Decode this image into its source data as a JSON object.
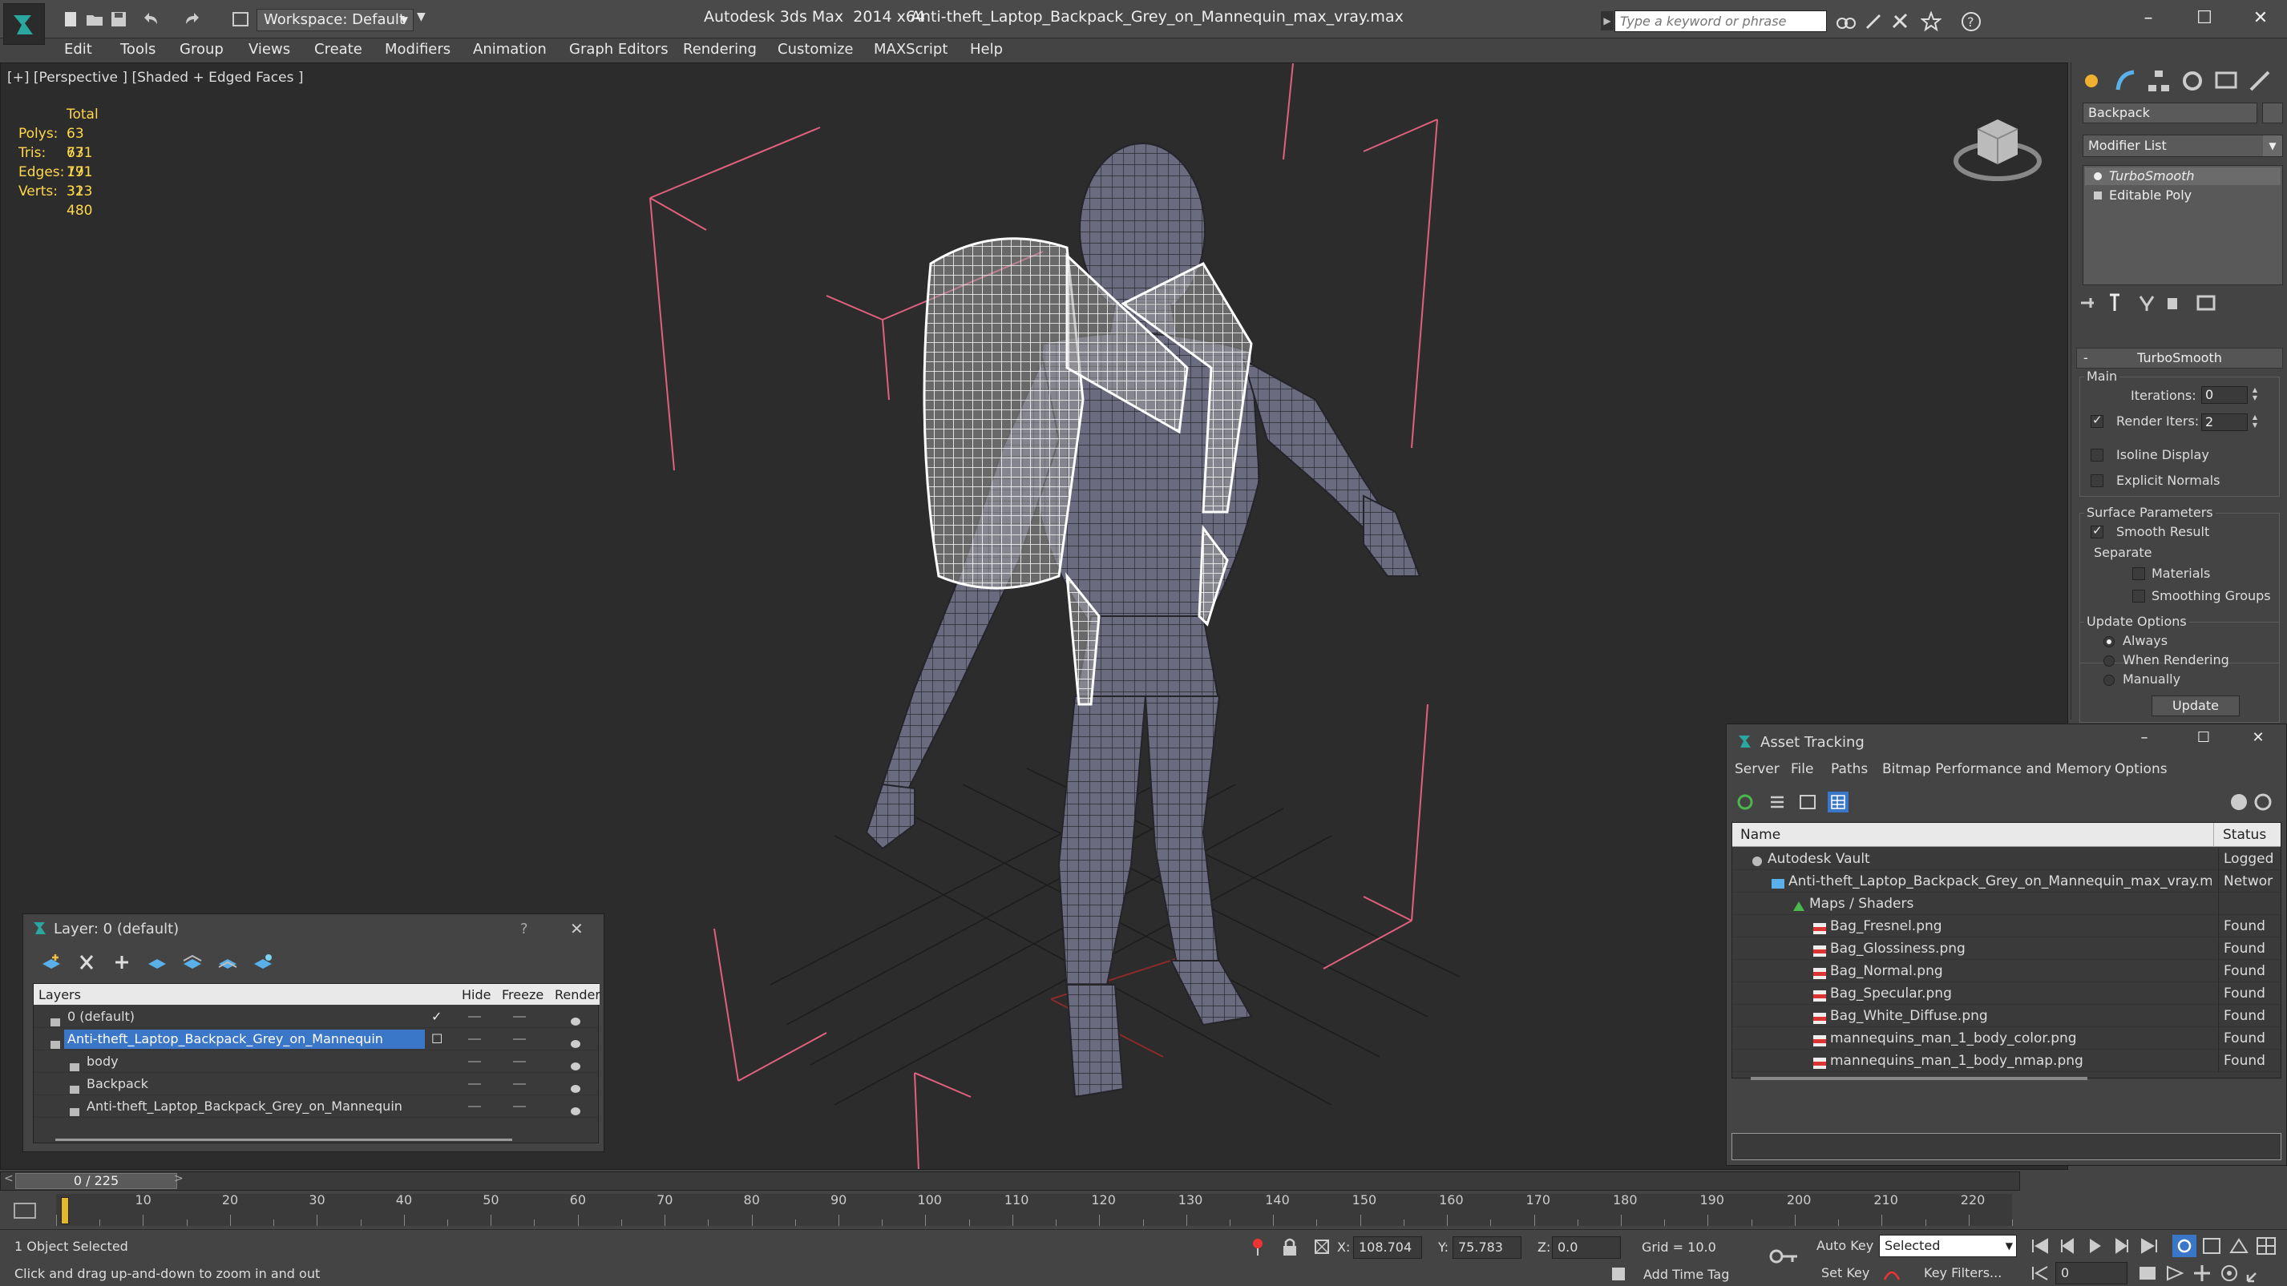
{
  "titlebar": {
    "workspace": "Workspace: Default",
    "app_title": "Autodesk 3ds Max  2014 x64",
    "document": "Anti-theft_Laptop_Backpack_Grey_on_Mannequin_max_vray.max",
    "search_placeholder": "Type a keyword or phrase",
    "help_label": "?"
  },
  "menu": [
    "Edit",
    "Tools",
    "Group",
    "Views",
    "Create",
    "Modifiers",
    "Animation",
    "Graph Editors",
    "Rendering",
    "Customize",
    "MAXScript",
    "Help"
  ],
  "viewport": {
    "label": "[+] [Perspective ] [Shaded + Edged Faces ]",
    "stats": {
      "header": "Total",
      "rows": [
        {
          "label": "Polys:",
          "value": "63 771"
        },
        {
          "label": "Tris:",
          "value": "63 771"
        },
        {
          "label": "Edges:",
          "value": "191 313"
        },
        {
          "label": "Verts:",
          "value": "32 480"
        }
      ]
    }
  },
  "command_panel": {
    "object_name": "Backpack",
    "modifier_list": "Modifier List",
    "stack": [
      "TurboSmooth",
      "Editable Poly"
    ],
    "rollout_title": "TurboSmooth",
    "main_label": "Main",
    "iterations_label": "Iterations:",
    "iterations_value": "0",
    "render_iters_label": "Render Iters:",
    "render_iters_value": "2",
    "isoline_label": "Isoline Display",
    "explicit_normals_label": "Explicit Normals",
    "surface_params_label": "Surface Parameters",
    "smooth_result_label": "Smooth Result",
    "separate_label": "Separate",
    "materials_label": "Materials",
    "smoothing_groups_label": "Smoothing Groups",
    "update_options_label": "Update Options",
    "always_label": "Always",
    "when_rendering_label": "When Rendering",
    "manually_label": "Manually",
    "update_button": "Update"
  },
  "asset_tracking": {
    "title": "Asset Tracking",
    "menu": [
      "Server",
      "File",
      "Paths",
      "Bitmap Performance and Memory",
      "Options"
    ],
    "col_name": "Name",
    "col_status": "Status",
    "rows": [
      {
        "name": "Autodesk Vault",
        "status": "Logged",
        "level": 0,
        "icon": "vault-icon"
      },
      {
        "name": "Anti-theft_Laptop_Backpack_Grey_on_Mannequin_max_vray.max",
        "status": "Networ",
        "level": 1,
        "icon": "max-file-icon"
      },
      {
        "name": "Maps / Shaders",
        "status": "",
        "level": 2,
        "icon": "maps-icon"
      },
      {
        "name": "Bag_Fresnel.png",
        "status": "Found",
        "level": 3,
        "icon": "png-icon"
      },
      {
        "name": "Bag_Glossiness.png",
        "status": "Found",
        "level": 3,
        "icon": "png-icon"
      },
      {
        "name": "Bag_Normal.png",
        "status": "Found",
        "level": 3,
        "icon": "png-icon"
      },
      {
        "name": "Bag_Specular.png",
        "status": "Found",
        "level": 3,
        "icon": "png-icon"
      },
      {
        "name": "Bag_White_Diffuse.png",
        "status": "Found",
        "level": 3,
        "icon": "png-icon"
      },
      {
        "name": "mannequins_man_1_body_color.png",
        "status": "Found",
        "level": 3,
        "icon": "png-icon"
      },
      {
        "name": "mannequins_man_1_body_nmap.png",
        "status": "Found",
        "level": 3,
        "icon": "png-icon"
      }
    ]
  },
  "layer_manager": {
    "title": "Layer: 0 (default)",
    "help": "?",
    "col_layers": "Layers",
    "col_hide": "Hide",
    "col_freeze": "Freeze",
    "col_render": "Render",
    "rows": [
      {
        "name": "0 (default)",
        "level": 0,
        "selected": false
      },
      {
        "name": "Anti-theft_Laptop_Backpack_Grey_on_Mannequin",
        "level": 0,
        "selected": true
      },
      {
        "name": "body",
        "level": 1,
        "selected": false
      },
      {
        "name": "Backpack",
        "level": 1,
        "selected": false
      },
      {
        "name": "Anti-theft_Laptop_Backpack_Grey_on_Mannequin",
        "level": 1,
        "selected": false
      }
    ]
  },
  "timeline": {
    "frame_display": "0 / 225",
    "ticks": [
      "10",
      "20",
      "30",
      "40",
      "50",
      "60",
      "70",
      "80",
      "90",
      "100",
      "110",
      "120",
      "130",
      "140",
      "150",
      "160",
      "170",
      "180",
      "190",
      "200",
      "210",
      "220"
    ]
  },
  "statusbar": {
    "selection": "1 Object Selected",
    "prompt": "Click and drag up-and-down to zoom in and out",
    "x_label": "X:",
    "x_value": "108.704",
    "y_label": "Y:",
    "y_value": "75.783",
    "z_label": "Z:",
    "z_value": "0.0",
    "grid": "Grid = 10.0",
    "add_time_tag": "Add Time Tag",
    "auto_key": "Auto Key",
    "set_key": "Set Key",
    "selected_dropdown": "Selected",
    "key_filters": "Key Filters...",
    "current_frame": "0"
  },
  "colors": {
    "stats_yellow": "#ffd84a",
    "selection_blue": "#3b77c9",
    "wire_white": "#ffffff",
    "bbox_pink": "#e0607e",
    "mannequin": "#6b6b80"
  }
}
